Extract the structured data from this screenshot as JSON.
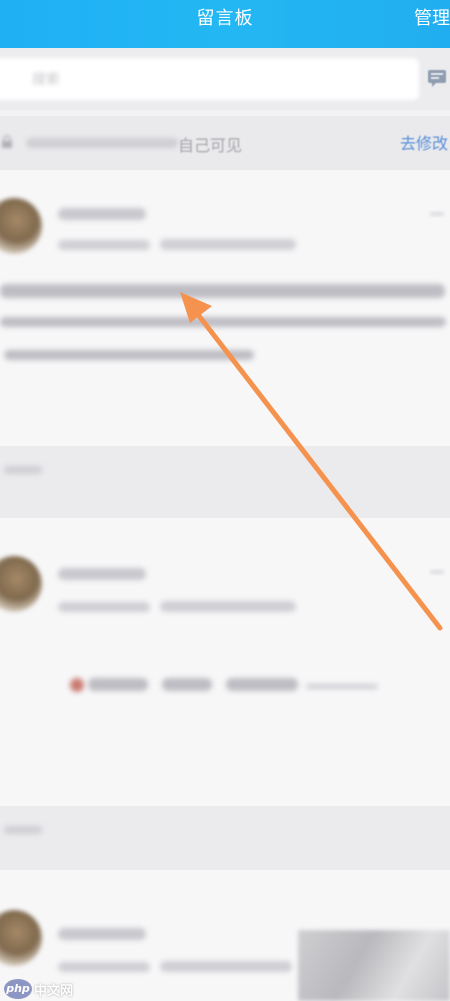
{
  "header": {
    "title": "留言板",
    "manage_label": "管理"
  },
  "search": {
    "placeholder": "搜索"
  },
  "visibility_bar": {
    "text": "自己可见",
    "edit_link": "去修改"
  },
  "watermark": {
    "logo_text": "php",
    "site_text": "中文网"
  },
  "colors": {
    "header_bg": "#21b3f3",
    "link": "#5a8fd8",
    "arrow": "#f4924e",
    "page_bg": "#f2f2f4"
  },
  "icons": [
    "message-icon",
    "lock-icon",
    "avatar",
    "arrow-annotation"
  ]
}
